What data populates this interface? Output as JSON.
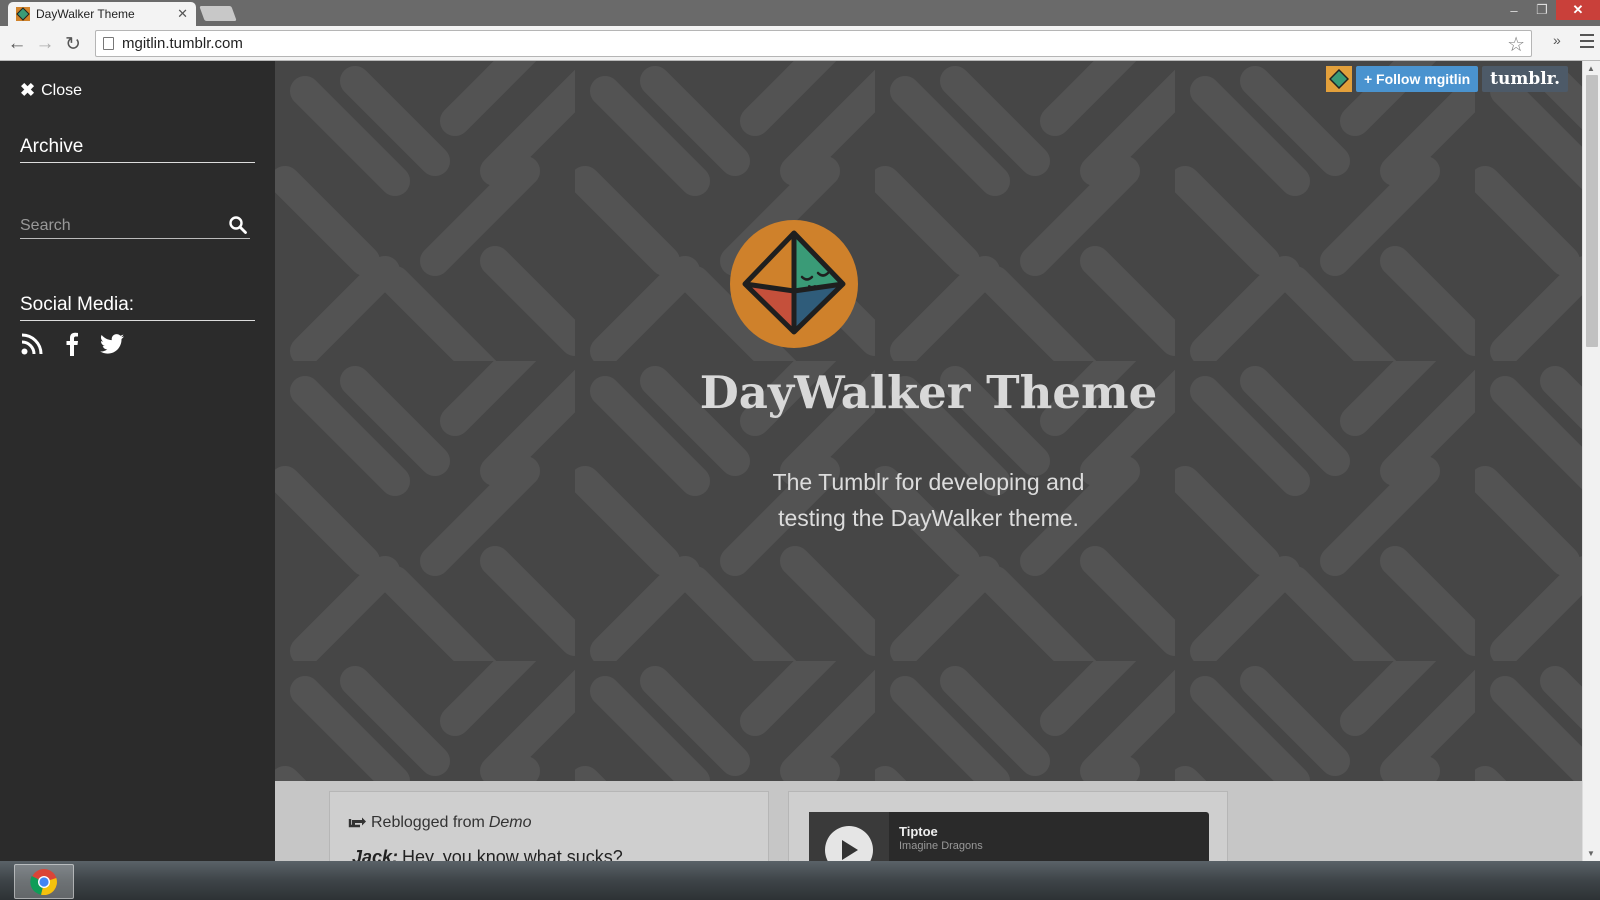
{
  "browser": {
    "tab_title": "DayWalker Theme",
    "tab_close": "✕",
    "url": "mgitlin.tumblr.com",
    "window_min": "‒",
    "window_max": "❐",
    "window_close": "✕",
    "back_icon": "←",
    "forward_icon": "→",
    "reload_icon": "↻",
    "bookmark_icon": "☆",
    "extensions_icon": "»"
  },
  "sidebar": {
    "close_icon": "✖",
    "close_label": "Close",
    "archive_label": "Archive",
    "search_placeholder": "Search",
    "social_heading": "Social Media:",
    "social_icons": [
      "rss-icon",
      "facebook-icon",
      "twitter-icon"
    ]
  },
  "header": {
    "title": "DayWalker Theme",
    "description_line1": "The Tumblr for developing and",
    "description_line2": "testing the DayWalker theme.",
    "follow_label": "+ Follow mgitlin",
    "tumblr_label": "tumblr.",
    "colors": {
      "logo_bg": "#d0822a",
      "header_bg": "#464646",
      "stripe": "#545454"
    }
  },
  "posts": [
    {
      "reblogged_prefix": "Reblogged from",
      "reblogged_source": "Demo",
      "speaker": "Jack:",
      "line": "Hey, you know what sucks?"
    },
    {
      "track": "Tiptoe",
      "artist": "Imagine Dragons"
    }
  ],
  "taskbar": {
    "pinned": [
      "chrome-icon"
    ]
  }
}
